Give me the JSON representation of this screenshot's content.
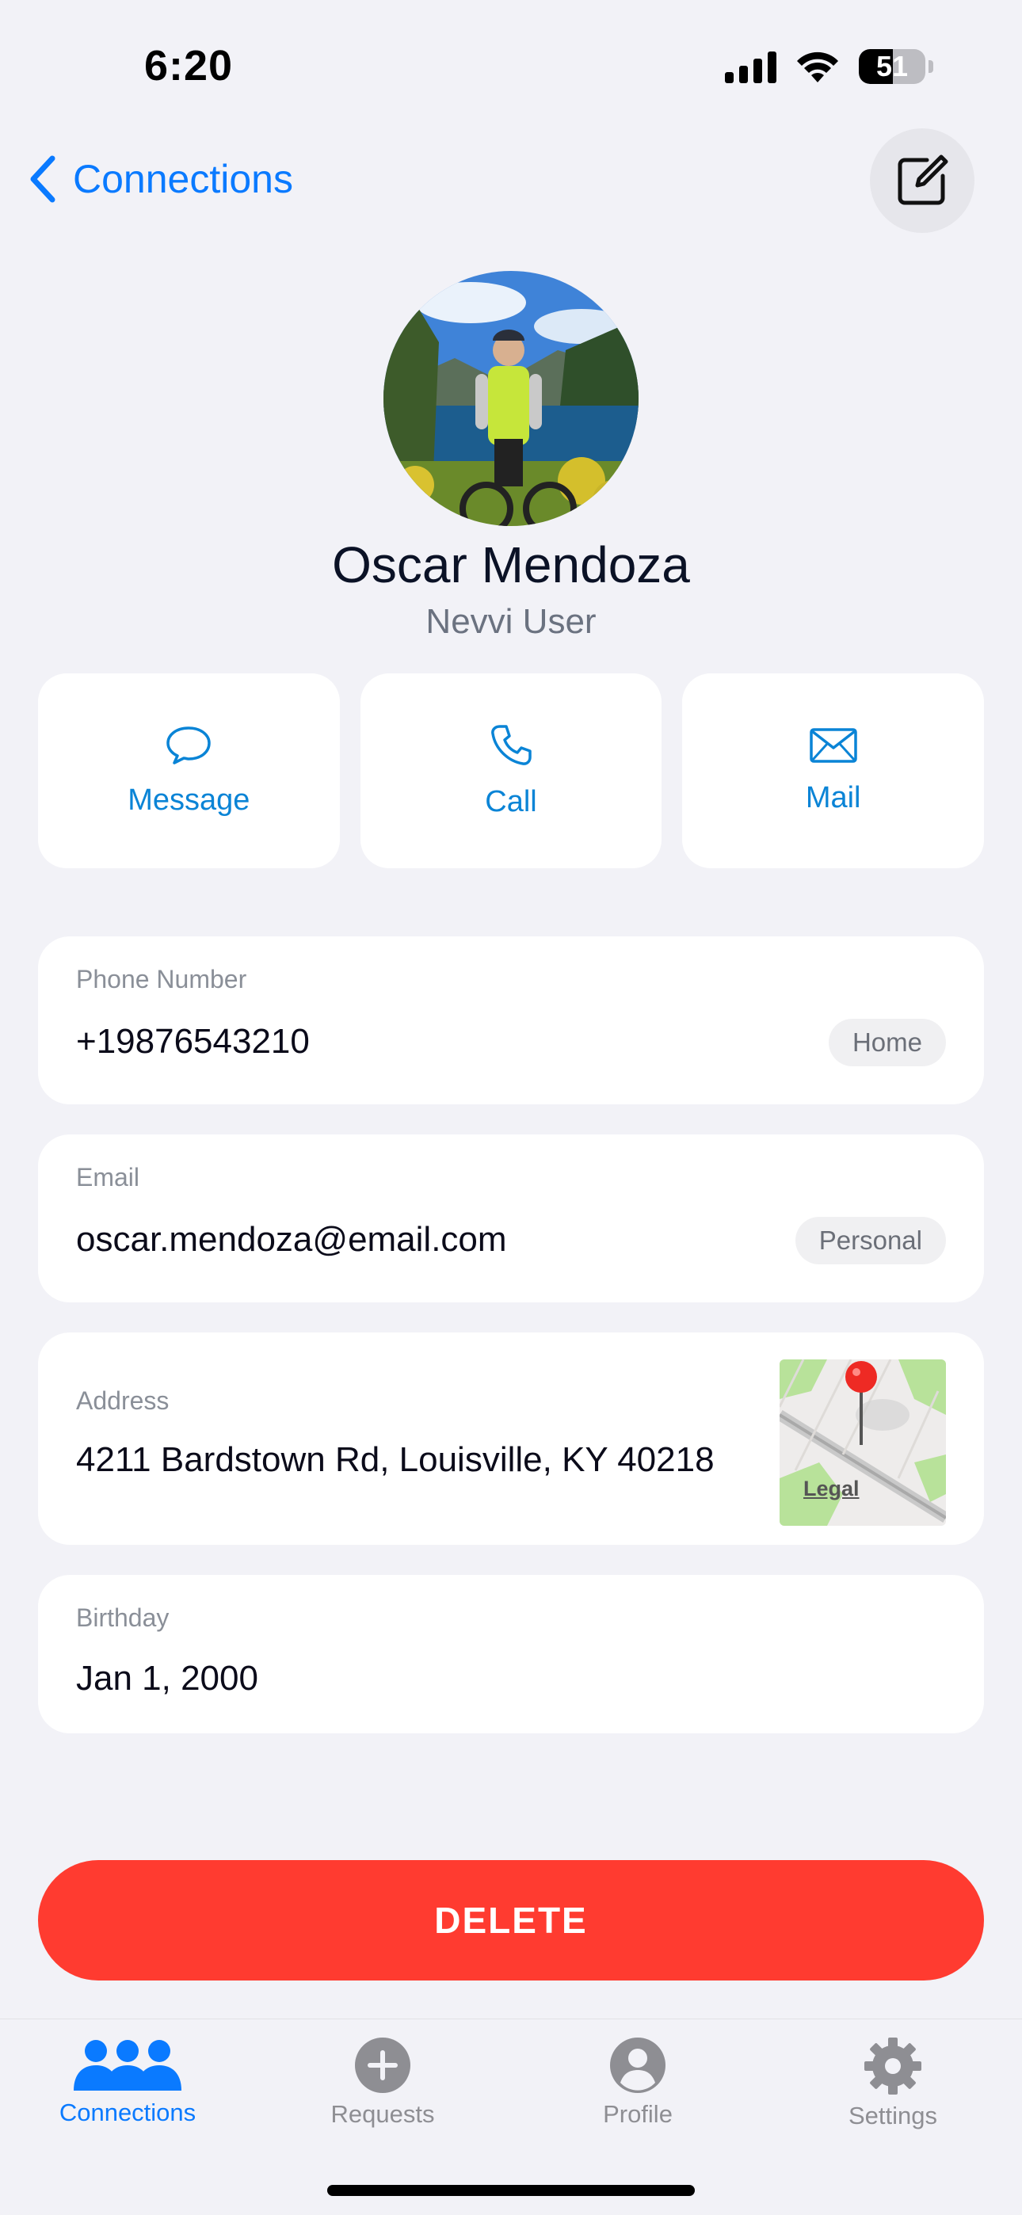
{
  "status_bar": {
    "time": "6:20",
    "battery": "51",
    "battery_level": 0.51
  },
  "nav": {
    "back_label": "Connections"
  },
  "contact": {
    "name": "Oscar Mendoza",
    "subtitle": "Nevvi User"
  },
  "actions": [
    {
      "label": "Message",
      "icon": "message-bubble-icon"
    },
    {
      "label": "Call",
      "icon": "phone-icon"
    },
    {
      "label": "Mail",
      "icon": "envelope-icon"
    }
  ],
  "fields": {
    "phone": {
      "label": "Phone Number",
      "value": "+19876543210",
      "tag": "Home"
    },
    "email": {
      "label": "Email",
      "value": "oscar.mendoza@email.com",
      "tag": "Personal"
    },
    "address": {
      "label": "Address",
      "value": "4211 Bardstown Rd, Louisville, KY 40218",
      "map_legal": "Legal"
    },
    "birthday": {
      "label": "Birthday",
      "value": "Jan 1, 2000"
    }
  },
  "delete_label": "DELETE",
  "tabs": [
    {
      "label": "Connections",
      "icon": "people-icon",
      "active": true
    },
    {
      "label": "Requests",
      "icon": "plus-circle-icon",
      "active": false
    },
    {
      "label": "Profile",
      "icon": "person-circle-icon",
      "active": false
    },
    {
      "label": "Settings",
      "icon": "gear-icon",
      "active": false
    }
  ],
  "colors": {
    "accent": "#0a7aff",
    "action_text": "#0a84d6",
    "danger": "#ff3b30",
    "background": "#f2f2f7"
  }
}
